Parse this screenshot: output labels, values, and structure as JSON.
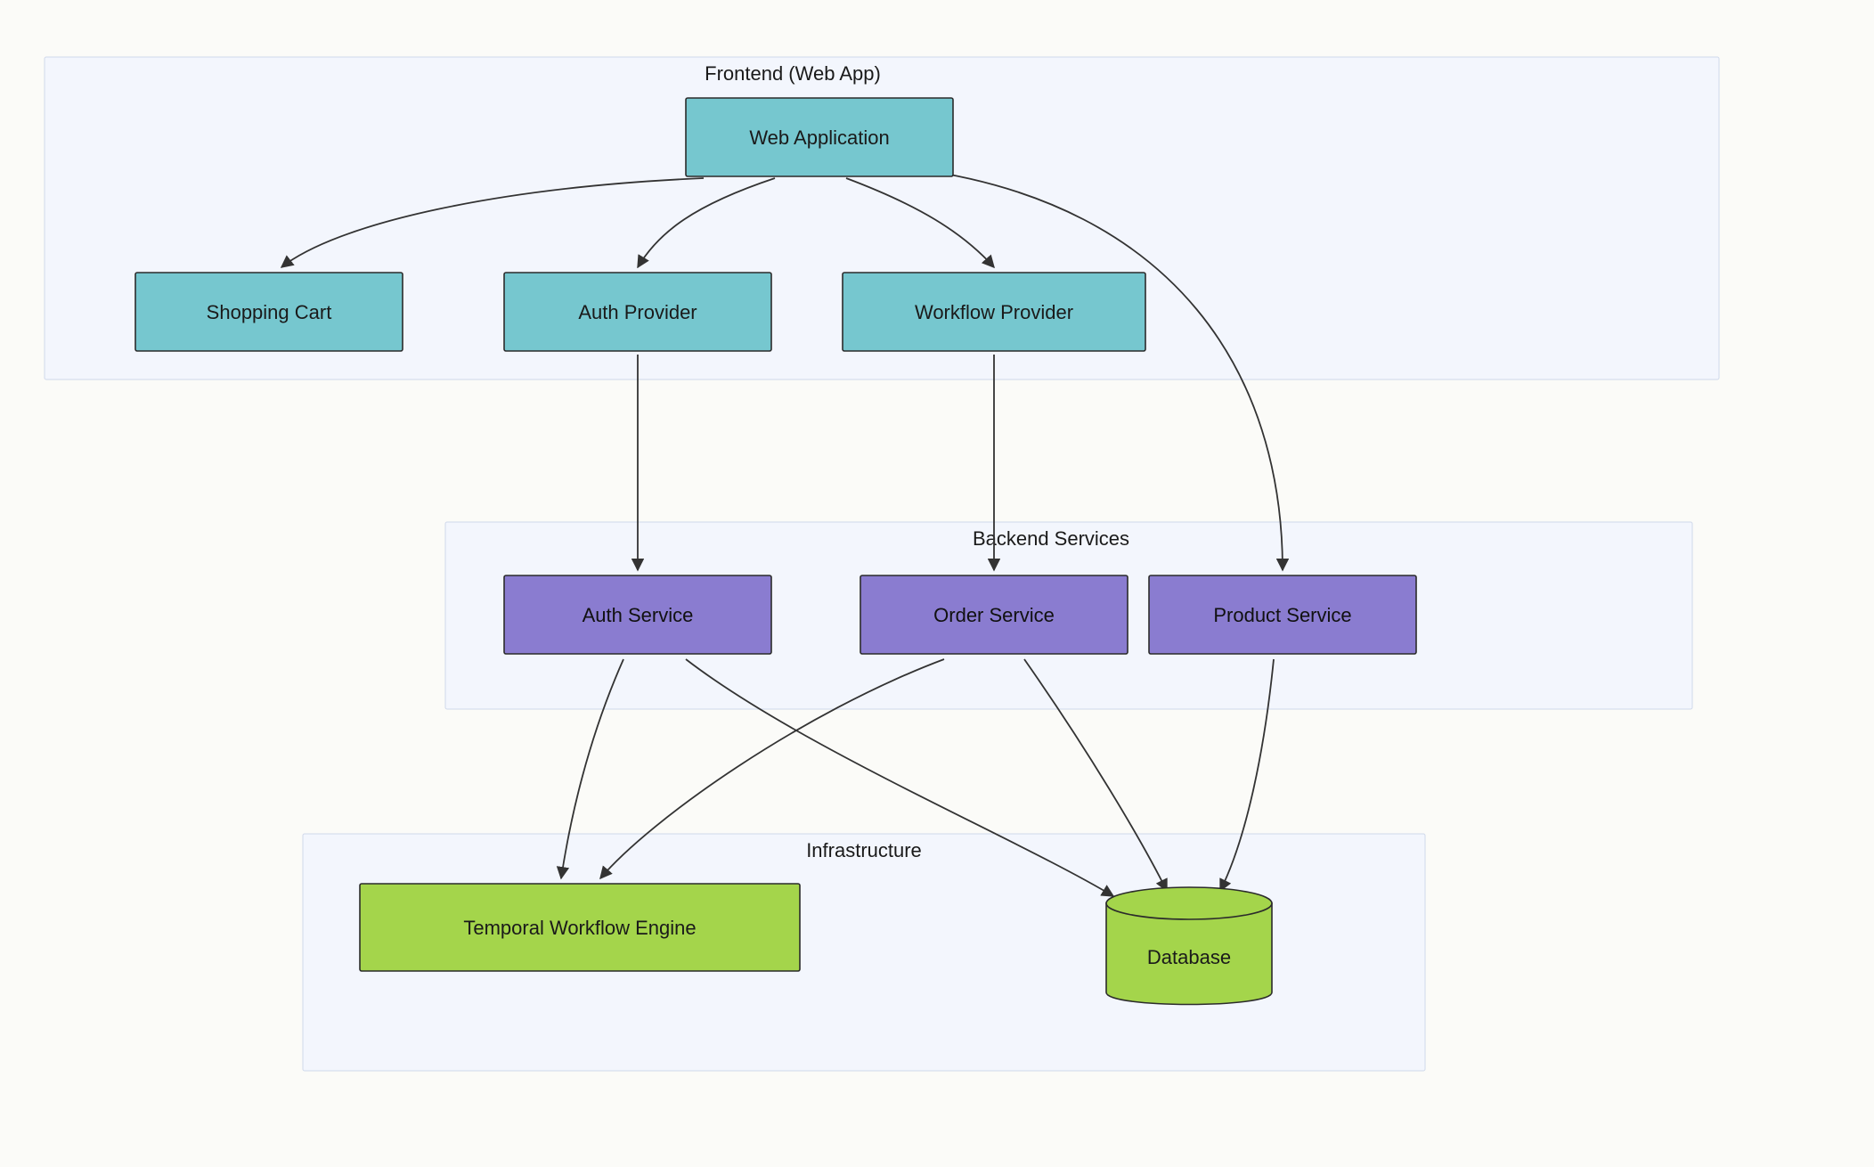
{
  "diagram": {
    "groups": {
      "frontend": {
        "label": "Frontend (Web App)"
      },
      "backend": {
        "label": "Backend Services"
      },
      "infra": {
        "label": "Infrastructure"
      }
    },
    "nodes": {
      "web_app": {
        "label": "Web Application",
        "group": "frontend",
        "color": "teal"
      },
      "cart": {
        "label": "Shopping Cart",
        "group": "frontend",
        "color": "teal"
      },
      "auth_prov": {
        "label": "Auth Provider",
        "group": "frontend",
        "color": "teal"
      },
      "wf_prov": {
        "label": "Workflow Provider",
        "group": "frontend",
        "color": "teal"
      },
      "auth_svc": {
        "label": "Auth Service",
        "group": "backend",
        "color": "purple"
      },
      "order_svc": {
        "label": "Order Service",
        "group": "backend",
        "color": "purple"
      },
      "product_svc": {
        "label": "Product Service",
        "group": "backend",
        "color": "purple"
      },
      "temporal": {
        "label": "Temporal Workflow Engine",
        "group": "infra",
        "color": "green"
      },
      "database": {
        "label": "Database",
        "group": "infra",
        "color": "green",
        "shape": "cylinder"
      }
    },
    "edges": [
      [
        "web_app",
        "cart"
      ],
      [
        "web_app",
        "auth_prov"
      ],
      [
        "web_app",
        "wf_prov"
      ],
      [
        "web_app",
        "product_svc"
      ],
      [
        "auth_prov",
        "auth_svc"
      ],
      [
        "wf_prov",
        "order_svc"
      ],
      [
        "auth_svc",
        "temporal"
      ],
      [
        "auth_svc",
        "database"
      ],
      [
        "order_svc",
        "temporal"
      ],
      [
        "order_svc",
        "database"
      ],
      [
        "product_svc",
        "database"
      ]
    ],
    "palette": {
      "teal": "#76c7cf",
      "purple": "#8a7cd0",
      "green": "#a4d54b",
      "group_bg": "#f0f4ff",
      "page_bg": "#fbfbf8"
    }
  }
}
